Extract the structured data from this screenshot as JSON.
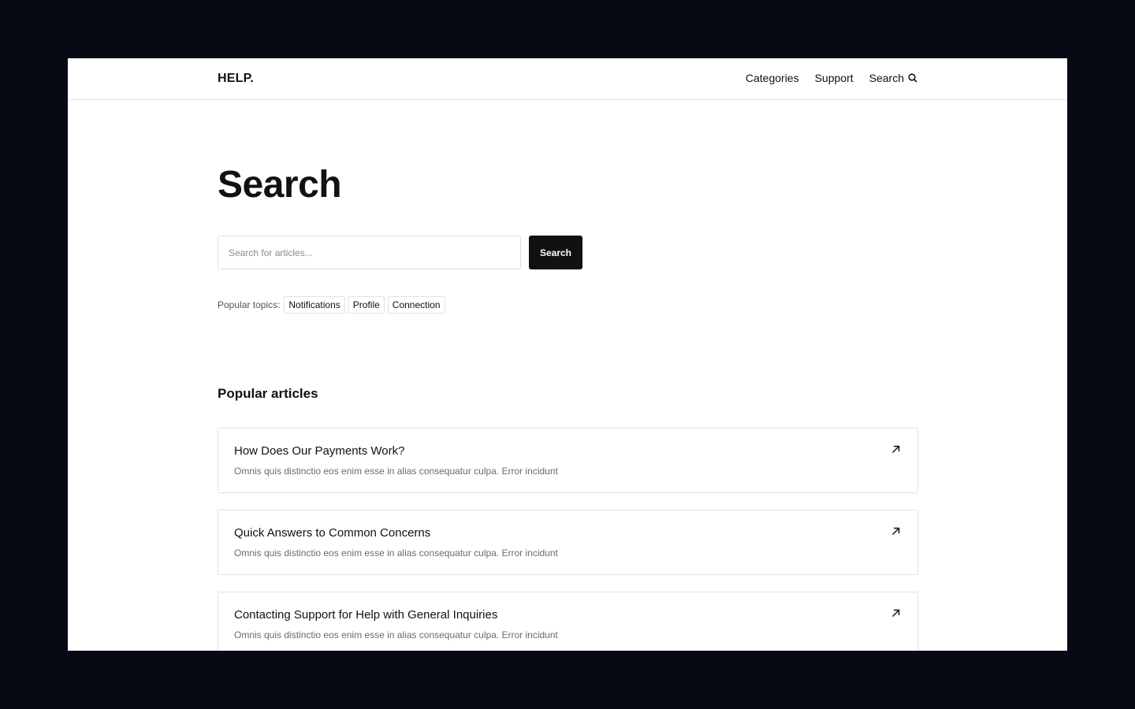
{
  "header": {
    "logo": "HELP.",
    "nav": {
      "categories": "Categories",
      "support": "Support",
      "search": "Search",
      "search_icon": "search-icon"
    }
  },
  "main": {
    "title": "Search",
    "search": {
      "placeholder": "Search for articles...",
      "value": "",
      "button_label": "Search"
    },
    "topics": {
      "label": "Popular topics:",
      "items": [
        "Notifications",
        "Profile",
        "Connection"
      ]
    },
    "popular": {
      "title": "Popular articles",
      "articles": [
        {
          "title": "How Does Our Payments Work?",
          "description": "Omnis quis distinctio eos enim esse in alias consequatur culpa. Error incidunt",
          "icon": "arrow-up-right-icon"
        },
        {
          "title": "Quick Answers to Common Concerns",
          "description": "Omnis quis distinctio eos enim esse in alias consequatur culpa. Error incidunt",
          "icon": "arrow-up-right-icon"
        },
        {
          "title": "Contacting Support for Help with General Inquiries",
          "description": "Omnis quis distinctio eos enim esse in alias consequatur culpa. Error incidunt",
          "icon": "arrow-up-right-icon"
        }
      ]
    }
  },
  "colors": {
    "frame_background": "#070a14",
    "page_background": "#ffffff",
    "primary": "#111111",
    "muted_text": "#6b6b6b",
    "border": "#e3e3e3"
  }
}
